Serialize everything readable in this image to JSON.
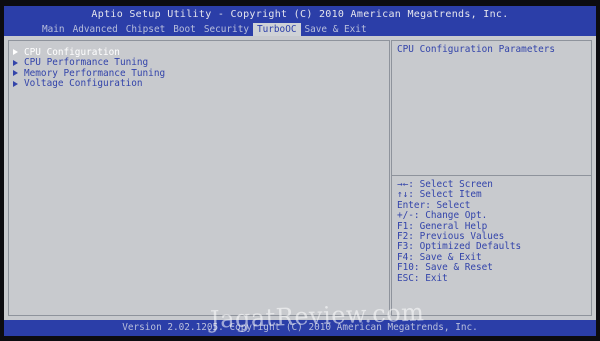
{
  "header": {
    "title": "Aptio Setup Utility - Copyright (C) 2010 American Megatrends, Inc.",
    "tabs": [
      "Main",
      "Advanced",
      "Chipset",
      "Boot",
      "Security",
      "TurboOC",
      "Save & Exit"
    ],
    "active_tab": "TurboOC"
  },
  "menu": {
    "items": [
      "CPU Configuration",
      "CPU Performance Tuning",
      "Memory Performance Tuning",
      "Voltage Configuration"
    ],
    "selected_index": 0
  },
  "help": {
    "title": "CPU Configuration Parameters",
    "keys": [
      "→←: Select Screen",
      "↑↓: Select Item",
      "Enter: Select",
      "+/-: Change Opt.",
      "F1: General Help",
      "F2: Previous Values",
      "F3: Optimized Defaults",
      "F4: Save & Exit",
      "F10: Save & Reset",
      "ESC: Exit"
    ]
  },
  "footer": {
    "text": "Version 2.02.1205. Copyright (C) 2010 American Megatrends, Inc."
  },
  "watermark": {
    "text": "JagatReview.com"
  },
  "colors": {
    "header_bg": "#2b3ea8",
    "panel_bg": "#c8cace",
    "text_blue": "#3344aa",
    "selected_text": "#ffffff"
  }
}
